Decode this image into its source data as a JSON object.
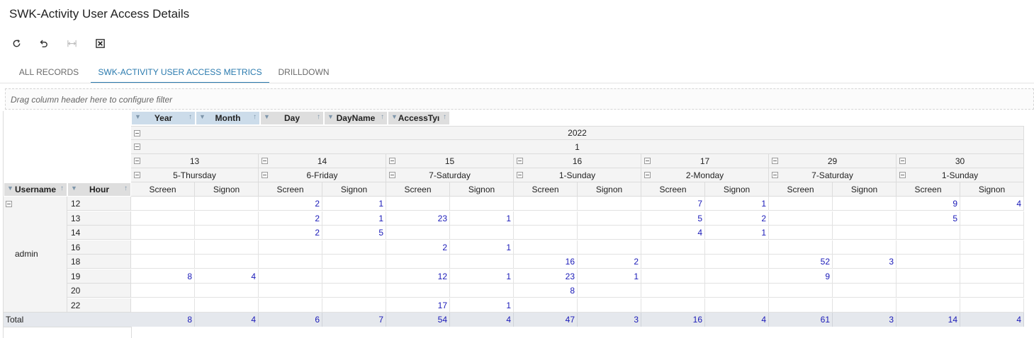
{
  "page": {
    "title": "SWK-Activity User Access Details"
  },
  "toolbar": [
    {
      "name": "refresh-button",
      "icon": "refresh-icon"
    },
    {
      "name": "undo-button",
      "icon": "undo-icon"
    },
    {
      "name": "fit-to-width-button",
      "icon": "fit-width-icon",
      "disabled": true
    },
    {
      "name": "export-excel-button",
      "icon": "excel-export-icon"
    }
  ],
  "tabs": [
    {
      "label": "ALL RECORDS",
      "active": false
    },
    {
      "label": "SWK-ACTIVITY USER ACCESS METRICS",
      "active": true
    },
    {
      "label": "DRILLDOWN",
      "active": false
    }
  ],
  "filter_bar": {
    "placeholder": "Drag column header here to configure filter"
  },
  "pivot": {
    "column_fields": [
      {
        "label": "Year",
        "active": true
      },
      {
        "label": "Month",
        "active": true
      },
      {
        "label": "Day",
        "active": false
      },
      {
        "label": "DayName",
        "active": false
      },
      {
        "label": "AccessTyı",
        "active": false
      }
    ],
    "row_fields": [
      {
        "label": "Username"
      },
      {
        "label": "Hour"
      }
    ],
    "year": "2022",
    "month": "1",
    "days": [
      {
        "day": "13",
        "dayname": "5-Thursday"
      },
      {
        "day": "14",
        "dayname": "6-Friday"
      },
      {
        "day": "15",
        "dayname": "7-Saturday"
      },
      {
        "day": "16",
        "dayname": "1-Sunday"
      },
      {
        "day": "17",
        "dayname": "2-Monday"
      },
      {
        "day": "29",
        "dayname": "7-Saturday"
      },
      {
        "day": "30",
        "dayname": "1-Sunday"
      }
    ],
    "access_types": [
      "Screen",
      "Signon"
    ],
    "username": "admin",
    "rows": [
      {
        "hour": "12",
        "values": [
          "",
          "",
          "2",
          "1",
          "",
          "",
          "",
          "",
          "7",
          "1",
          "",
          "",
          "9",
          "4"
        ]
      },
      {
        "hour": "13",
        "values": [
          "",
          "",
          "2",
          "1",
          "23",
          "1",
          "",
          "",
          "5",
          "2",
          "",
          "",
          "5",
          ""
        ]
      },
      {
        "hour": "14",
        "values": [
          "",
          "",
          "2",
          "5",
          "",
          "",
          "",
          "",
          "4",
          "1",
          "",
          "",
          "",
          ""
        ]
      },
      {
        "hour": "16",
        "values": [
          "",
          "",
          "",
          "",
          "2",
          "1",
          "",
          "",
          "",
          "",
          "",
          "",
          "",
          ""
        ]
      },
      {
        "hour": "18",
        "values": [
          "",
          "",
          "",
          "",
          "",
          "",
          "16",
          "2",
          "",
          "",
          "52",
          "3",
          "",
          ""
        ]
      },
      {
        "hour": "19",
        "values": [
          "8",
          "4",
          "",
          "",
          "12",
          "1",
          "23",
          "1",
          "",
          "",
          "9",
          "",
          "",
          ""
        ]
      },
      {
        "hour": "20",
        "values": [
          "",
          "",
          "",
          "",
          "",
          "",
          "8",
          "",
          "",
          "",
          "",
          "",
          "",
          ""
        ]
      },
      {
        "hour": "22",
        "values": [
          "",
          "",
          "",
          "",
          "17",
          "1",
          "",
          "",
          "",
          "",
          "",
          "",
          "",
          ""
        ]
      }
    ],
    "total_label": "Total",
    "totals": [
      "8",
      "4",
      "6",
      "7",
      "54",
      "4",
      "47",
      "3",
      "16",
      "4",
      "61",
      "3",
      "14",
      "4"
    ]
  }
}
